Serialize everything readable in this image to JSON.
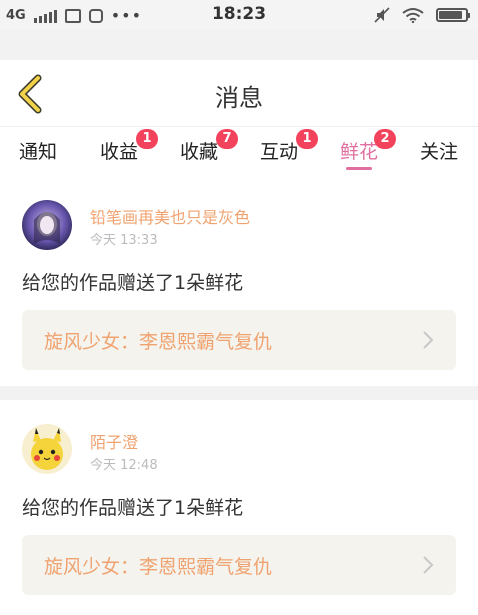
{
  "status_bar": {
    "network": "4G",
    "time": "18:23",
    "icons": [
      "signal-icon",
      "sim-icon",
      "notification-icon",
      "more-dots-icon",
      "mute-icon",
      "wifi-icon",
      "battery-icon"
    ],
    "battery_level": 0.9
  },
  "header": {
    "title": "消息",
    "back_icon": "chevron-left-icon",
    "accent": "#f2d24a"
  },
  "tabs": [
    {
      "label": "通知",
      "badge": ""
    },
    {
      "label": "收益",
      "badge": "1"
    },
    {
      "label": "收藏",
      "badge": "7"
    },
    {
      "label": "互动",
      "badge": "1"
    },
    {
      "label": "鲜花",
      "badge": "2",
      "active": true
    },
    {
      "label": "关注",
      "badge": ""
    }
  ],
  "messages": [
    {
      "username": "铅笔画再美也只是灰色",
      "time": "今天 13:33",
      "text": "给您的作品赠送了1朵鲜花",
      "work_title": "旋风少女：李恩熙霸气复仇"
    },
    {
      "username": "陌子澄",
      "time": "今天 12:48",
      "text": "给您的作品赠送了1朵鲜花",
      "work_title": "旋风少女：李恩熙霸气复仇"
    }
  ],
  "colors": {
    "active_tab": "#e06fa0",
    "badge": "#f2425c",
    "username": "#f0a370",
    "work_bg": "#f4f3ee"
  }
}
